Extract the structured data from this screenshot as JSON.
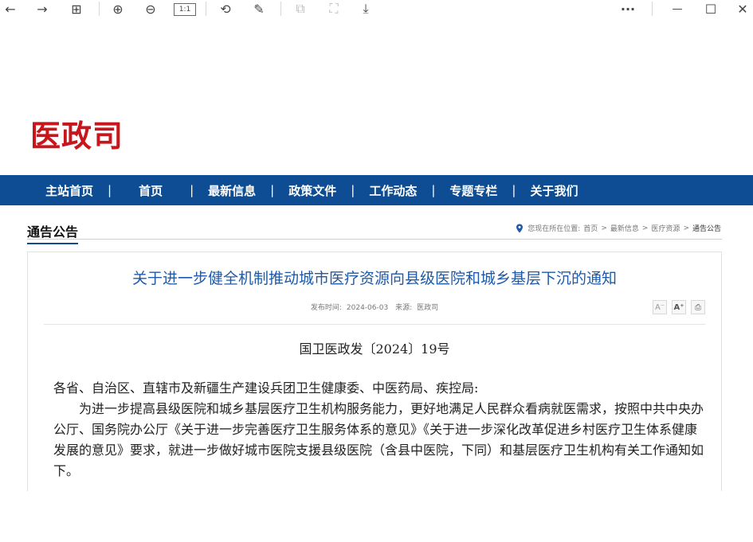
{
  "toolbar": {
    "icons": [
      "back-arrow-icon",
      "forward-arrow-icon",
      "grid-icon",
      "zoom-in-icon",
      "zoom-out-icon",
      "actual-size-icon",
      "rotate-icon",
      "edit-icon",
      "crop-icon",
      "fullscreen-icon",
      "download-icon",
      "more-icon",
      "minimize-icon",
      "maximize-icon",
      "close-icon"
    ],
    "glyphs": {
      "back": "←",
      "forward": "→",
      "grid": "⊞",
      "zoom_in": "⊕",
      "zoom_out": "⊖",
      "actual": "1:1",
      "rotate": "⟲",
      "edit": "✎",
      "crop": "⧉",
      "fullscreen": "⛶",
      "download": "⤓",
      "more": "···",
      "minimize": "—",
      "maximize": "☐",
      "close": "✕"
    }
  },
  "logo": "医政司",
  "nav": {
    "items": [
      "主站首页",
      "首页",
      "最新信息",
      "政策文件",
      "工作动态",
      "专题专栏",
      "关于我们"
    ],
    "divider": "|"
  },
  "section": {
    "title": "通告公告",
    "breadcrumb": {
      "prefix": "您现在所在位置:",
      "path": [
        "首页",
        "最新信息",
        "医疗资源",
        "通告公告"
      ],
      "sep": ">"
    }
  },
  "article": {
    "title": "关于进一步健全机制推动城市医疗资源向县级医院和城乡基层下沉的通知",
    "meta": {
      "date_label": "发布时间:",
      "date": "2024-06-03",
      "source_label": "来源:",
      "source": "医政司"
    },
    "tools": {
      "font_smaller": "A⁻",
      "font_larger": "A⁺",
      "print": "⎙"
    },
    "doc_number": "国卫医政发〔2024〕19号",
    "salutation": "各省、自治区、直辖市及新疆生产建设兵团卫生健康委、中医药局、疾控局:",
    "paragraph1": "为进一步提高县级医院和城乡基层医疗卫生机构服务能力，更好地满足人民群众看病就医需求，按照中共中央办公厅、国务院办公厅《关于进一步完善医疗卫生服务体系的意见》《关于进一步深化改革促进乡村医疗卫生体系健康发展的意见》要求，就进一步做好城市医院支援县级医院（含县中医院，下同）和基层医疗卫生机构有关工作通知如下。"
  }
}
